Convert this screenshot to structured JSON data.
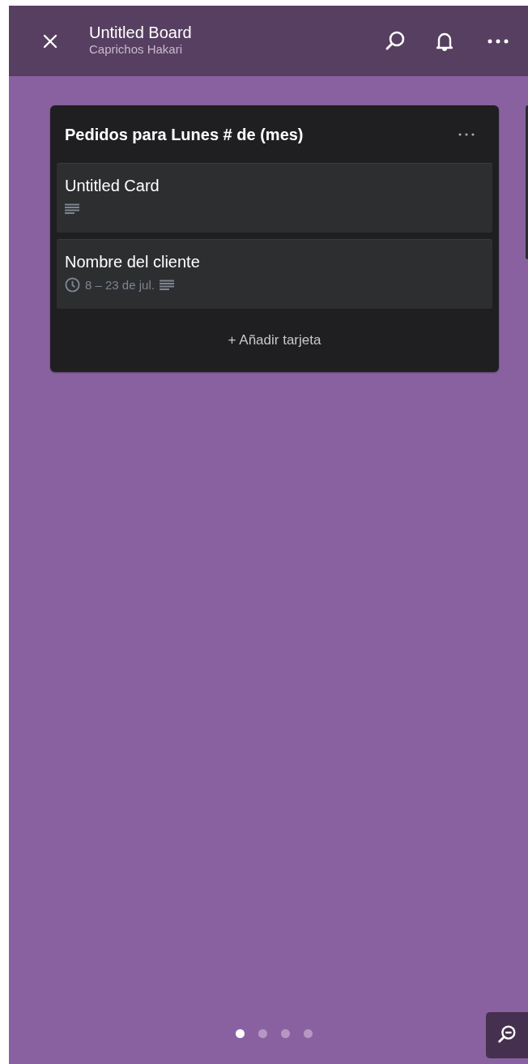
{
  "header": {
    "title": "Untitled Board",
    "subtitle": "Caprichos Hakari"
  },
  "list": {
    "title": "Pedidos para Lunes # de (mes)",
    "cards": [
      {
        "title": "Untitled Card",
        "description": true
      },
      {
        "title": "Nombre del cliente",
        "dates": "8 – 23 de jul.",
        "description": true
      }
    ],
    "add_card": "+ Añadir tarjeta"
  },
  "pages": [
    {
      "selected": true
    },
    {
      "selected": false
    },
    {
      "selected": false
    },
    {
      "selected": false
    }
  ]
}
